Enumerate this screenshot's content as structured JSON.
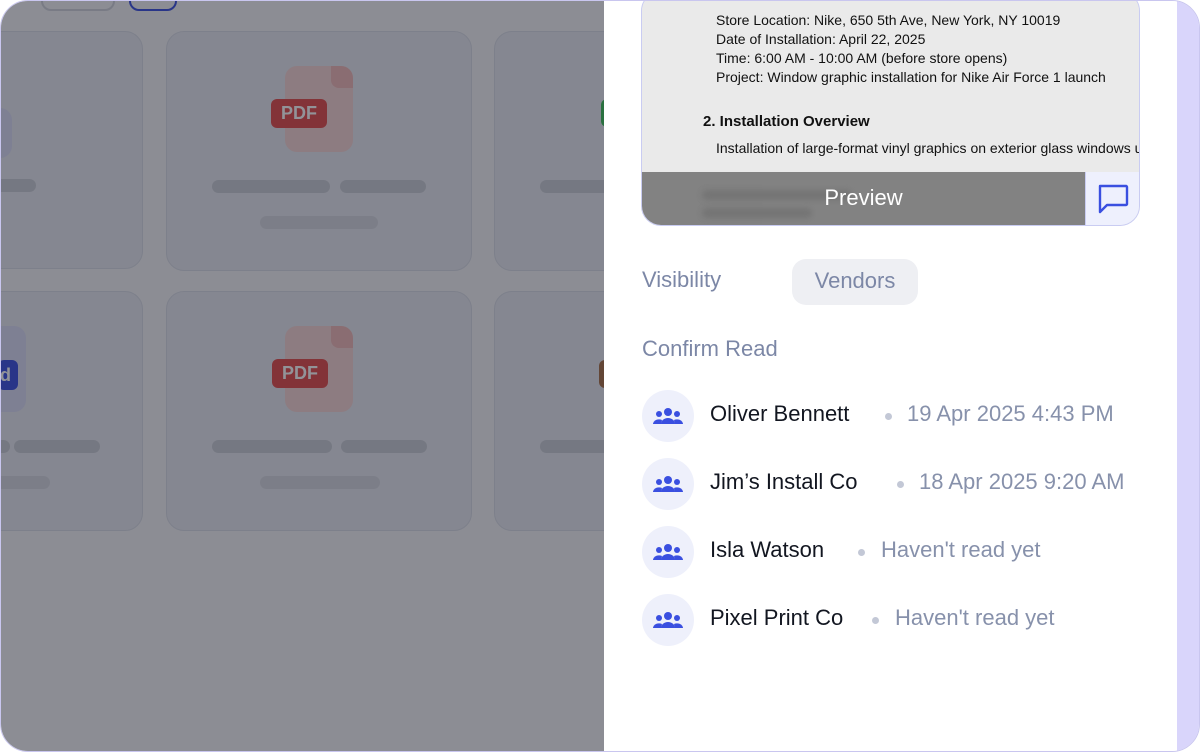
{
  "background_grid": {
    "file_badge": "PDF",
    "partial_badge": "d"
  },
  "preview": {
    "document_lines": [
      "Store Location: Nike, 650 5th Ave, New York, NY 10019",
      "Date of Installation: April 22, 2025",
      "Time: 6:00 AM - 10:00 AM (before store opens)",
      "Project: Window graphic installation for Nike Air Force 1 launch"
    ],
    "section_heading": "2. Installation Overview",
    "section_text": "Installation of large-format vinyl graphics on exterior glass windows u",
    "preview_label": "Preview",
    "comment_icon": "comment-icon"
  },
  "visibility": {
    "label": "Visibility",
    "value": "Vendors"
  },
  "confirm_read": {
    "title": "Confirm Read",
    "readers": [
      {
        "name": "Oliver Bennett",
        "status": "19 Apr 2025 4:43 PM",
        "read": true
      },
      {
        "name": "Jim’s Install Co",
        "status": "18 Apr 2025 9:20 AM",
        "read": true
      },
      {
        "name": "Isla Watson",
        "status": "Haven't read yet",
        "read": false
      },
      {
        "name": "Pixel Print Co",
        "status": "Haven't read yet",
        "read": false
      }
    ]
  },
  "colors": {
    "accent": "#3a4fe0",
    "muted_text": "#7c87a6",
    "overlay": "#181a24",
    "pdf_red": "#e34a4a"
  }
}
